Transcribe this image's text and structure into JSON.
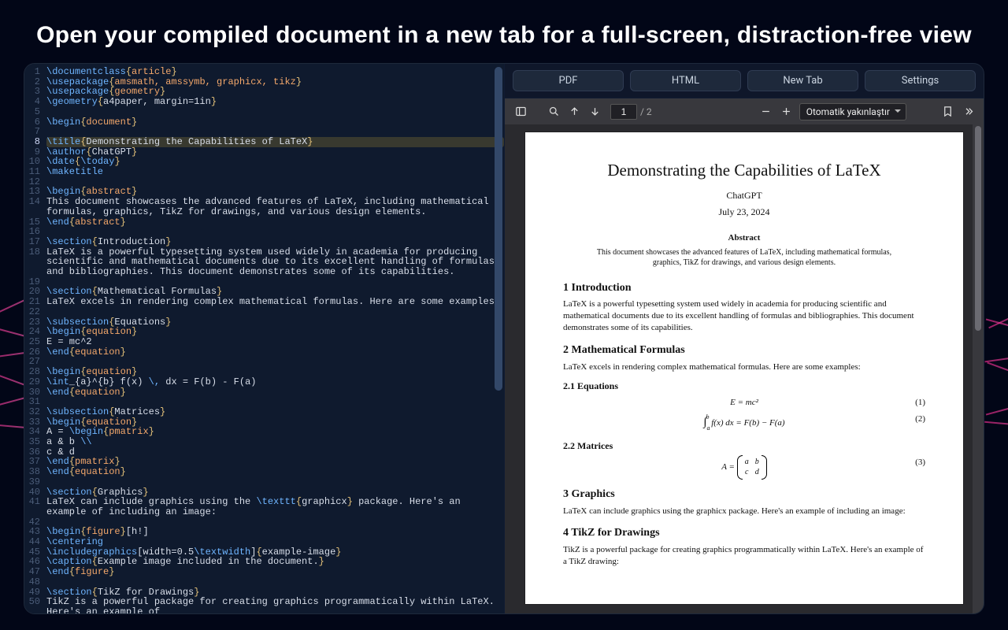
{
  "headline": "Open your compiled document in a new tab for a full-screen, distraction-free view",
  "editor": {
    "highlight_line": 8,
    "lines": [
      {
        "n": 1,
        "seg": [
          [
            "cmd",
            "\\documentclass"
          ],
          [
            "br",
            "{"
          ],
          [
            "arg",
            "article"
          ],
          [
            "br",
            "}"
          ]
        ]
      },
      {
        "n": 2,
        "seg": [
          [
            "cmd",
            "\\usepackage"
          ],
          [
            "br",
            "{"
          ],
          [
            "arg",
            "amsmath, amssymb, graphicx, tikz"
          ],
          [
            "br",
            "}"
          ]
        ]
      },
      {
        "n": 3,
        "seg": [
          [
            "cmd",
            "\\usepackage"
          ],
          [
            "br",
            "{"
          ],
          [
            "arg",
            "geometry"
          ],
          [
            "br",
            "}"
          ]
        ]
      },
      {
        "n": 4,
        "seg": [
          [
            "cmd",
            "\\geometry"
          ],
          [
            "br",
            "{"
          ],
          [
            "txt",
            "a4paper, margin=1in"
          ],
          [
            "br",
            "}"
          ]
        ]
      },
      {
        "n": 5,
        "seg": []
      },
      {
        "n": 6,
        "seg": [
          [
            "cmd",
            "\\begin"
          ],
          [
            "br",
            "{"
          ],
          [
            "arg",
            "document"
          ],
          [
            "br",
            "}"
          ]
        ]
      },
      {
        "n": 7,
        "seg": []
      },
      {
        "n": 8,
        "seg": [
          [
            "cmd",
            "\\title"
          ],
          [
            "br",
            "{"
          ],
          [
            "txt",
            "Demonstrating the Capabilities of LaTeX"
          ],
          [
            "br",
            "}"
          ]
        ]
      },
      {
        "n": 9,
        "seg": [
          [
            "cmd",
            "\\author"
          ],
          [
            "br",
            "{"
          ],
          [
            "txt",
            "ChatGPT"
          ],
          [
            "br",
            "}"
          ]
        ]
      },
      {
        "n": 10,
        "seg": [
          [
            "cmd",
            "\\date"
          ],
          [
            "br",
            "{"
          ],
          [
            "cmd",
            "\\today"
          ],
          [
            "br",
            "}"
          ]
        ]
      },
      {
        "n": 11,
        "seg": [
          [
            "cmd",
            "\\maketitle"
          ]
        ]
      },
      {
        "n": 12,
        "seg": []
      },
      {
        "n": 13,
        "seg": [
          [
            "cmd",
            "\\begin"
          ],
          [
            "br",
            "{"
          ],
          [
            "arg",
            "abstract"
          ],
          [
            "br",
            "}"
          ]
        ]
      },
      {
        "n": 14,
        "seg": [
          [
            "txt",
            "This document showcases the advanced features of LaTeX, including mathematical formulas, graphics, TikZ for drawings, and various design elements."
          ]
        ]
      },
      {
        "n": 15,
        "seg": [
          [
            "cmd",
            "\\end"
          ],
          [
            "br",
            "{"
          ],
          [
            "arg",
            "abstract"
          ],
          [
            "br",
            "}"
          ]
        ]
      },
      {
        "n": 16,
        "seg": []
      },
      {
        "n": 17,
        "seg": [
          [
            "cmd",
            "\\section"
          ],
          [
            "br",
            "{"
          ],
          [
            "txt",
            "Introduction"
          ],
          [
            "br",
            "}"
          ]
        ]
      },
      {
        "n": 18,
        "seg": [
          [
            "txt",
            "LaTeX is a powerful typesetting system used widely in academia for producing scientific and mathematical documents due to its excellent handling of formulas and bibliographies. This document demonstrates some of its capabilities."
          ]
        ]
      },
      {
        "n": 19,
        "seg": []
      },
      {
        "n": 20,
        "seg": [
          [
            "cmd",
            "\\section"
          ],
          [
            "br",
            "{"
          ],
          [
            "txt",
            "Mathematical Formulas"
          ],
          [
            "br",
            "}"
          ]
        ]
      },
      {
        "n": 21,
        "seg": [
          [
            "txt",
            "LaTeX excels in rendering complex mathematical formulas. Here are some examples:"
          ]
        ]
      },
      {
        "n": 22,
        "seg": []
      },
      {
        "n": 23,
        "seg": [
          [
            "cmd",
            "\\subsection"
          ],
          [
            "br",
            "{"
          ],
          [
            "txt",
            "Equations"
          ],
          [
            "br",
            "}"
          ]
        ]
      },
      {
        "n": 24,
        "seg": [
          [
            "cmd",
            "\\begin"
          ],
          [
            "br",
            "{"
          ],
          [
            "arg",
            "equation"
          ],
          [
            "br",
            "}"
          ]
        ]
      },
      {
        "n": 25,
        "seg": [
          [
            "txt",
            "E = mc^2"
          ]
        ]
      },
      {
        "n": 26,
        "seg": [
          [
            "cmd",
            "\\end"
          ],
          [
            "br",
            "{"
          ],
          [
            "arg",
            "equation"
          ],
          [
            "br",
            "}"
          ]
        ]
      },
      {
        "n": 27,
        "seg": []
      },
      {
        "n": 28,
        "seg": [
          [
            "cmd",
            "\\begin"
          ],
          [
            "br",
            "{"
          ],
          [
            "arg",
            "equation"
          ],
          [
            "br",
            "}"
          ]
        ]
      },
      {
        "n": 29,
        "seg": [
          [
            "cmd",
            "\\int"
          ],
          [
            "txt",
            "_{a}^{b} f(x) "
          ],
          [
            "cmd",
            "\\,"
          ],
          [
            "txt",
            " dx = F(b) - F(a)"
          ]
        ]
      },
      {
        "n": 30,
        "seg": [
          [
            "cmd",
            "\\end"
          ],
          [
            "br",
            "{"
          ],
          [
            "arg",
            "equation"
          ],
          [
            "br",
            "}"
          ]
        ]
      },
      {
        "n": 31,
        "seg": []
      },
      {
        "n": 32,
        "seg": [
          [
            "cmd",
            "\\subsection"
          ],
          [
            "br",
            "{"
          ],
          [
            "txt",
            "Matrices"
          ],
          [
            "br",
            "}"
          ]
        ]
      },
      {
        "n": 33,
        "seg": [
          [
            "cmd",
            "\\begin"
          ],
          [
            "br",
            "{"
          ],
          [
            "arg",
            "equation"
          ],
          [
            "br",
            "}"
          ]
        ]
      },
      {
        "n": 34,
        "seg": [
          [
            "txt",
            "A = "
          ],
          [
            "cmd",
            "\\begin"
          ],
          [
            "br",
            "{"
          ],
          [
            "arg",
            "pmatrix"
          ],
          [
            "br",
            "}"
          ]
        ]
      },
      {
        "n": 35,
        "seg": [
          [
            "txt",
            "a & b "
          ],
          [
            "cmd",
            "\\\\"
          ]
        ]
      },
      {
        "n": 36,
        "seg": [
          [
            "txt",
            "c & d"
          ]
        ]
      },
      {
        "n": 37,
        "seg": [
          [
            "cmd",
            "\\end"
          ],
          [
            "br",
            "{"
          ],
          [
            "arg",
            "pmatrix"
          ],
          [
            "br",
            "}"
          ]
        ]
      },
      {
        "n": 38,
        "seg": [
          [
            "cmd",
            "\\end"
          ],
          [
            "br",
            "{"
          ],
          [
            "arg",
            "equation"
          ],
          [
            "br",
            "}"
          ]
        ]
      },
      {
        "n": 39,
        "seg": []
      },
      {
        "n": 40,
        "seg": [
          [
            "cmd",
            "\\section"
          ],
          [
            "br",
            "{"
          ],
          [
            "txt",
            "Graphics"
          ],
          [
            "br",
            "}"
          ]
        ]
      },
      {
        "n": 41,
        "seg": [
          [
            "txt",
            "LaTeX can include graphics using the "
          ],
          [
            "cmd",
            "\\texttt"
          ],
          [
            "br",
            "{"
          ],
          [
            "txt",
            "graphicx"
          ],
          [
            "br",
            "}"
          ],
          [
            "txt",
            " package. Here's an example of including an image:"
          ]
        ]
      },
      {
        "n": 42,
        "seg": []
      },
      {
        "n": 43,
        "seg": [
          [
            "cmd",
            "\\begin"
          ],
          [
            "br",
            "{"
          ],
          [
            "arg",
            "figure"
          ],
          [
            "br",
            "}"
          ],
          [
            "txt",
            "[h!]"
          ]
        ]
      },
      {
        "n": 44,
        "seg": [
          [
            "cmd",
            "\\centering"
          ]
        ]
      },
      {
        "n": 45,
        "seg": [
          [
            "cmd",
            "\\includegraphics"
          ],
          [
            "txt",
            "[width=0.5"
          ],
          [
            "cmd",
            "\\textwidth"
          ],
          [
            "txt",
            "]"
          ],
          [
            "br",
            "{"
          ],
          [
            "txt",
            "example-image"
          ],
          [
            "br",
            "}"
          ]
        ]
      },
      {
        "n": 46,
        "seg": [
          [
            "cmd",
            "\\caption"
          ],
          [
            "br",
            "{"
          ],
          [
            "txt",
            "Example image included in the document."
          ],
          [
            "br",
            "}"
          ]
        ]
      },
      {
        "n": 47,
        "seg": [
          [
            "cmd",
            "\\end"
          ],
          [
            "br",
            "{"
          ],
          [
            "arg",
            "figure"
          ],
          [
            "br",
            "}"
          ]
        ]
      },
      {
        "n": 48,
        "seg": []
      },
      {
        "n": 49,
        "seg": [
          [
            "cmd",
            "\\section"
          ],
          [
            "br",
            "{"
          ],
          [
            "txt",
            "TikZ for Drawings"
          ],
          [
            "br",
            "}"
          ]
        ]
      },
      {
        "n": 50,
        "seg": [
          [
            "txt",
            "TikZ is a powerful package for creating graphics programmatically within LaTeX. Here's an example of"
          ]
        ]
      }
    ]
  },
  "tabs": {
    "pdf": "PDF",
    "html": "HTML",
    "newtab": "New Tab",
    "settings": "Settings"
  },
  "pdfbar": {
    "page": "1",
    "pages": "/ 2",
    "zoom": "Otomatik yakınlaştır"
  },
  "preview": {
    "title": "Demonstrating the Capabilities of LaTeX",
    "author": "ChatGPT",
    "date": "July 23, 2024",
    "abstract_label": "Abstract",
    "abstract": "This document showcases the advanced features of LaTeX, including mathematical formulas, graphics, TikZ for drawings, and various design elements.",
    "s1": "1   Introduction",
    "p1": "LaTeX is a powerful typesetting system used widely in academia for producing scientific and mathematical documents due to its excellent handling of formulas and bibliographies. This document demonstrates some of its capabilities.",
    "s2": "2   Mathematical Formulas",
    "p2": "LaTeX excels in rendering complex mathematical formulas. Here are some examples:",
    "s2_1": "2.1   Equations",
    "eq1": "E = mc²",
    "eq1_tag": "(1)",
    "eq2_tag": "(2)",
    "s2_2": "2.2   Matrices",
    "eq3_lhs": "A =",
    "eq3_tag": "(3)",
    "s3": "3   Graphics",
    "p3": "LaTeX can include graphics using the graphicx package. Here's an example of including an image:",
    "s4": "4   TikZ for Drawings",
    "p4": "TikZ is a powerful package for creating graphics programmatically within LaTeX. Here's an example of a TikZ drawing:"
  }
}
